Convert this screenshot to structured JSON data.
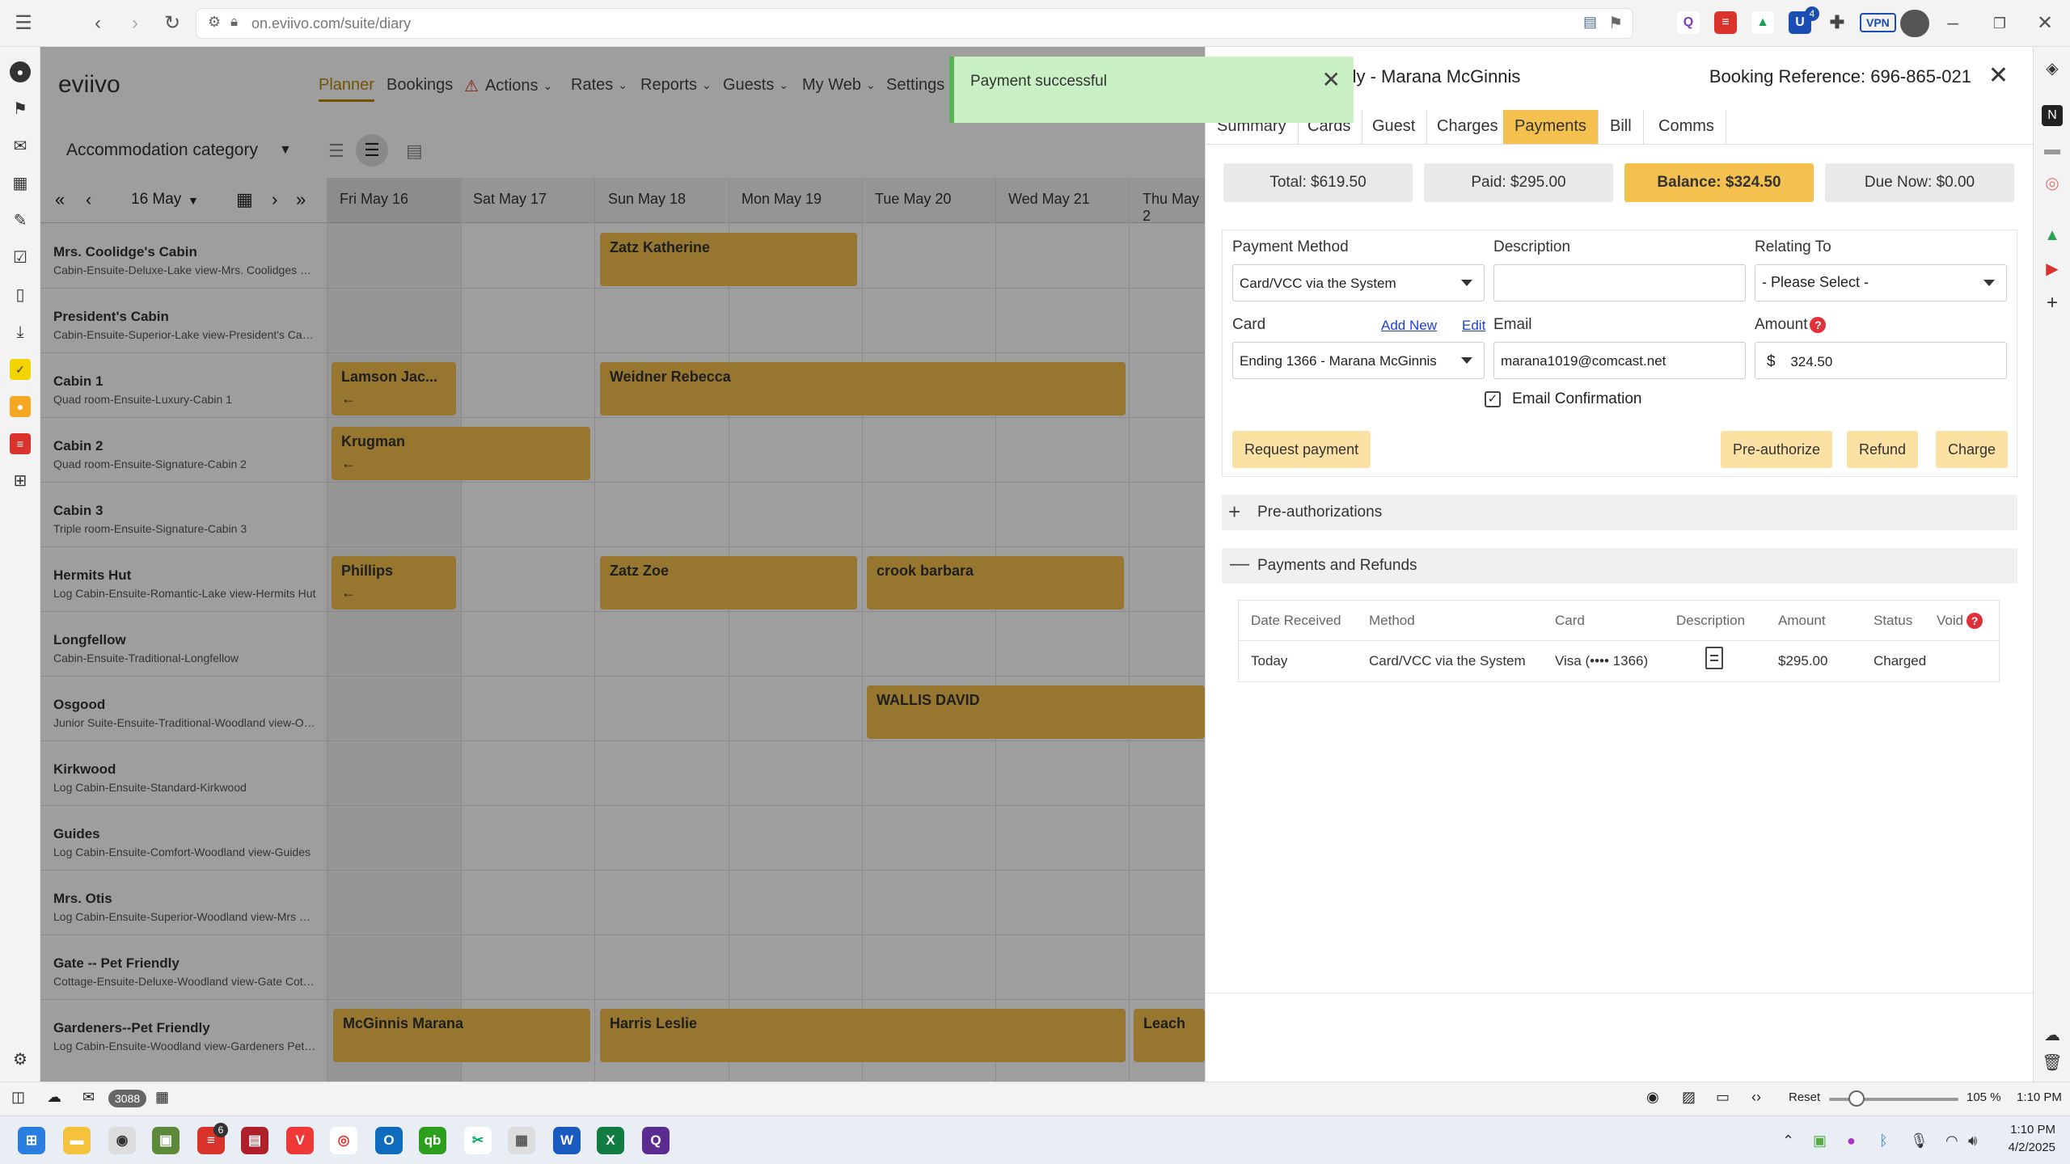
{
  "browser": {
    "url": "on.eviivo.com/suite/diary",
    "extension_badge": "4",
    "vpn_label": "VPN"
  },
  "statusbar": {
    "count": "3088",
    "reset_label": "Reset",
    "zoom": "105 %",
    "time": "1:10 PM"
  },
  "taskbar": {
    "time": "1:10 PM",
    "date": "4/2/2025",
    "app_badge": "6"
  },
  "app": {
    "logo": "eviivo",
    "nav": [
      "Planner",
      "Bookings",
      "Actions",
      "Rates",
      "Reports",
      "Guests",
      "My Web",
      "Settings"
    ],
    "category_select": "Accommodation category",
    "date_picker": "16 May",
    "days": [
      "Fri May 16",
      "Sat May 17",
      "Sun May 18",
      "Mon May 19",
      "Tue May 20",
      "Wed May 21",
      "Thu May 2"
    ],
    "rooms": [
      {
        "name": "Mrs. Coolidge's Cabin",
        "desc": "Cabin-Ensuite-Deluxe-Lake view-Mrs. Coolidges Cabin"
      },
      {
        "name": "President's Cabin",
        "desc": "Cabin-Ensuite-Superior-Lake view-President's Cabin"
      },
      {
        "name": "Cabin 1",
        "desc": "Quad room-Ensuite-Luxury-Cabin 1"
      },
      {
        "name": "Cabin 2",
        "desc": "Quad room-Ensuite-Signature-Cabin 2"
      },
      {
        "name": "Cabin 3",
        "desc": "Triple room-Ensuite-Signature-Cabin 3"
      },
      {
        "name": "Hermits Hut",
        "desc": "Log Cabin-Ensuite-Romantic-Lake view-Hermits Hut"
      },
      {
        "name": "Longfellow",
        "desc": "Cabin-Ensuite-Traditional-Longfellow"
      },
      {
        "name": "Osgood",
        "desc": "Junior Suite-Ensuite-Traditional-Woodland view-Osgood"
      },
      {
        "name": "Kirkwood",
        "desc": "Log Cabin-Ensuite-Standard-Kirkwood"
      },
      {
        "name": "Guides",
        "desc": "Log Cabin-Ensuite-Comfort-Woodland view-Guides"
      },
      {
        "name": "Mrs. Otis",
        "desc": "Log Cabin-Ensuite-Superior-Woodland view-Mrs Otis"
      },
      {
        "name": "Gate -- Pet Friendly",
        "desc": "Cottage-Ensuite-Deluxe-Woodland view-Gate Cottage"
      },
      {
        "name": "Gardeners--Pet Friendly",
        "desc": "Log Cabin-Ensuite-Woodland view-Gardeners Pet Friendly"
      }
    ],
    "bookings": [
      {
        "guest": "Zatz Katherine"
      },
      {
        "guest": "Lamson Jac..."
      },
      {
        "guest": "Weidner Rebecca"
      },
      {
        "guest": "Krugman"
      },
      {
        "guest": "Phillips"
      },
      {
        "guest": "Zatz Zoe"
      },
      {
        "guest": "crook barbara"
      },
      {
        "guest": "WALLIS DAVID"
      },
      {
        "guest": "McGinnis Marana"
      },
      {
        "guest": "Harris Leslie"
      },
      {
        "guest": "Leach"
      }
    ]
  },
  "toast": {
    "message": "Payment successful"
  },
  "panel": {
    "title": "iendly - Marana McGinnis",
    "booking_ref": "Booking Reference: 696-865-021",
    "tabs": [
      "Summary",
      "Cards",
      "Guest",
      "Charges",
      "Payments",
      "Bill",
      "Comms"
    ],
    "totals": {
      "total": "Total: $619.50",
      "paid": "Paid: $295.00",
      "balance": "Balance: $324.50",
      "due_now": "Due Now: $0.00"
    },
    "form": {
      "payment_method_label": "Payment Method",
      "payment_method_value": "Card/VCC via the System",
      "description_label": "Description",
      "description_value": "",
      "relating_to_label": "Relating To",
      "relating_to_value": "- Please Select -",
      "card_label": "Card",
      "add_new_link": "Add New",
      "edit_link": "Edit",
      "card_value": "Ending 1366 - Marana McGinnis",
      "email_label": "Email",
      "email_value": "marana1019@comcast.net",
      "amount_label": "Amount",
      "currency_symbol": "$",
      "amount_value": "324.50",
      "email_confirmation_label": "Email Confirmation",
      "email_confirmation_checked": true
    },
    "buttons": {
      "request_payment": "Request payment",
      "preauthorize": "Pre-authorize",
      "refund": "Refund",
      "charge": "Charge"
    },
    "preauth_section": "Pre-authorizations",
    "payments_section": "Payments and Refunds",
    "table": {
      "headers": [
        "Date Received",
        "Method",
        "Card",
        "Description",
        "Amount",
        "Status",
        "Void"
      ],
      "rows": [
        {
          "date": "Today",
          "method": "Card/VCC via the System",
          "card": "Visa (•••• 1366)",
          "amount": "$295.00",
          "status": "Charged"
        }
      ]
    }
  },
  "colors": {
    "accent": "#f4c14e",
    "toast_bg": "#c9efc5",
    "link": "#1f3fd1",
    "help": "#e0303a"
  }
}
